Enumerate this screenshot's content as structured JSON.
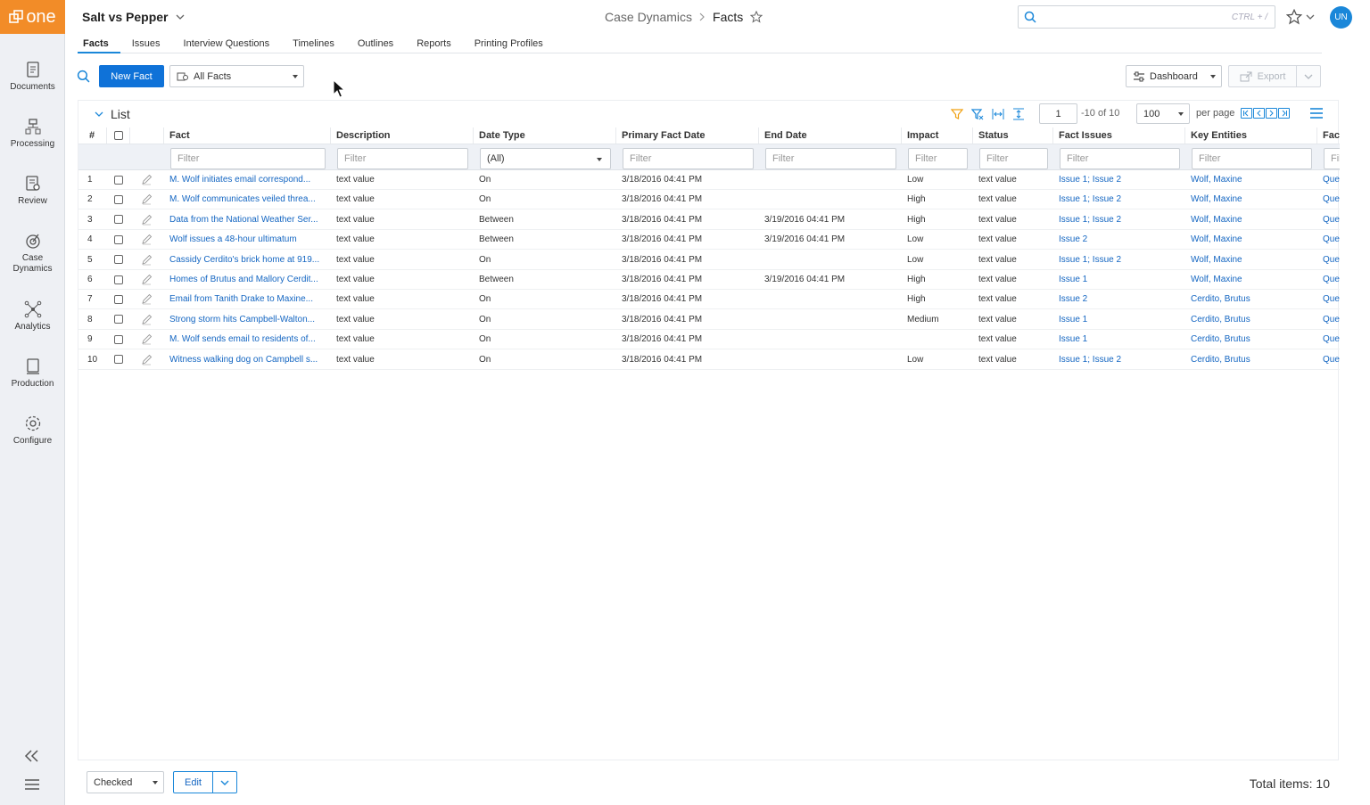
{
  "app": {
    "logo_text": "one"
  },
  "sidebar": {
    "items": [
      {
        "label": "Documents",
        "icon": "documents-icon"
      },
      {
        "label": "Processing",
        "icon": "processing-icon"
      },
      {
        "label": "Review",
        "icon": "review-icon"
      },
      {
        "label": "Case Dynamics",
        "icon": "case-dynamics-icon"
      },
      {
        "label": "Analytics",
        "icon": "analytics-icon"
      },
      {
        "label": "Production",
        "icon": "production-icon"
      },
      {
        "label": "Configure",
        "icon": "configure-icon"
      }
    ]
  },
  "header": {
    "case_name": "Salt vs Pepper",
    "breadcrumb_parent": "Case Dynamics",
    "breadcrumb_current": "Facts",
    "search_hint": "CTRL + /",
    "avatar_initials": "UN"
  },
  "tabs": [
    "Facts",
    "Issues",
    "Interview Questions",
    "Timelines",
    "Outlines",
    "Reports",
    "Printing Profiles"
  ],
  "toolbar": {
    "new_button": "New Fact",
    "view_selector": "All Facts",
    "dashboard_button": "Dashboard",
    "export_button": "Export"
  },
  "list": {
    "title": "List",
    "page": "1",
    "page_range": "-10 of 10",
    "per_page_value": "100",
    "per_page_label": "per page",
    "filter_placeholder": "Filter",
    "date_type_filter": "(All)",
    "columns": [
      "#",
      "Fact",
      "Description",
      "Date Type",
      "Primary Fact Date",
      "End Date",
      "Impact",
      "Status",
      "Fact Issues",
      "Key Entities",
      "Fac"
    ],
    "rows": [
      {
        "num": "1",
        "fact": "M. Wolf initiates email correspond...",
        "description": "text value",
        "date_type": "On",
        "primary_date": "3/18/2016 04:41 PM",
        "end_date": "",
        "impact": "Low",
        "status": "text value",
        "issues": "Issue 1; Issue 2",
        "entities": "Wolf, Maxine",
        "extra": "Que"
      },
      {
        "num": "2",
        "fact": "M. Wolf communicates veiled threa...",
        "description": "text value",
        "date_type": "On",
        "primary_date": "3/18/2016 04:41 PM",
        "end_date": "",
        "impact": "High",
        "status": "text value",
        "issues": "Issue 1; Issue 2",
        "entities": "Wolf, Maxine",
        "extra": "Que"
      },
      {
        "num": "3",
        "fact": "Data from the National Weather Ser...",
        "description": "text value",
        "date_type": "Between",
        "primary_date": "3/18/2016 04:41 PM",
        "end_date": "3/19/2016 04:41 PM",
        "impact": "High",
        "status": "text value",
        "issues": "Issue 1; Issue 2",
        "entities": "Wolf, Maxine",
        "extra": "Que"
      },
      {
        "num": "4",
        "fact": "Wolf issues a 48-hour ultimatum",
        "description": "text value",
        "date_type": "Between",
        "primary_date": "3/18/2016 04:41 PM",
        "end_date": "3/19/2016 04:41 PM",
        "impact": "Low",
        "status": "text value",
        "issues": "Issue 2",
        "entities": "Wolf, Maxine",
        "extra": "Que"
      },
      {
        "num": "5",
        "fact": "Cassidy Cerdito's brick home at 919...",
        "description": "text value",
        "date_type": "On",
        "primary_date": "3/18/2016 04:41 PM",
        "end_date": "",
        "impact": "Low",
        "status": "text value",
        "issues": "Issue 1; Issue 2",
        "entities": "Wolf, Maxine",
        "extra": "Que"
      },
      {
        "num": "6",
        "fact": "Homes of Brutus and Mallory Cerdit...",
        "description": "text value",
        "date_type": "Between",
        "primary_date": "3/18/2016 04:41 PM",
        "end_date": "3/19/2016 04:41 PM",
        "impact": "High",
        "status": "text value",
        "issues": "Issue 1",
        "entities": "Wolf, Maxine",
        "extra": "Que"
      },
      {
        "num": "7",
        "fact": " Email from Tanith Drake to Maxine...",
        "description": "text value",
        "date_type": "On",
        "primary_date": "3/18/2016 04:41 PM",
        "end_date": "",
        "impact": "High",
        "status": "text value",
        "issues": "Issue 2",
        "entities": "Cerdito, Brutus",
        "extra": "Que"
      },
      {
        "num": "8",
        "fact": "Strong storm hits Campbell-Walton...",
        "description": "text value",
        "date_type": "On",
        "primary_date": "3/18/2016 04:41 PM",
        "end_date": "",
        "impact": "Medium",
        "status": "text value",
        "issues": "Issue 1",
        "entities": "Cerdito, Brutus",
        "extra": "Que"
      },
      {
        "num": "9",
        "fact": "M. Wolf sends email to residents of...",
        "description": "text value",
        "date_type": "On",
        "primary_date": "3/18/2016 04:41 PM",
        "end_date": "",
        "impact": "",
        "status": "text value",
        "issues": "Issue 1",
        "entities": "Cerdito, Brutus",
        "extra": "Que"
      },
      {
        "num": "10",
        "fact": "Witness walking dog on Campbell s...",
        "description": "text value",
        "date_type": "On",
        "primary_date": "3/18/2016 04:41 PM",
        "end_date": "",
        "impact": "Low",
        "status": "text value",
        "issues": "Issue 1; Issue 2",
        "entities": "Cerdito, Brutus",
        "extra": "Que"
      }
    ]
  },
  "footer": {
    "bulk_selector": "Checked",
    "edit_button": "Edit",
    "total_label": "Total items: 10"
  },
  "colors": {
    "accent": "#1a87d9",
    "logo": "#f28c28",
    "link": "#1466c2",
    "primary_button": "#0f72d8"
  }
}
